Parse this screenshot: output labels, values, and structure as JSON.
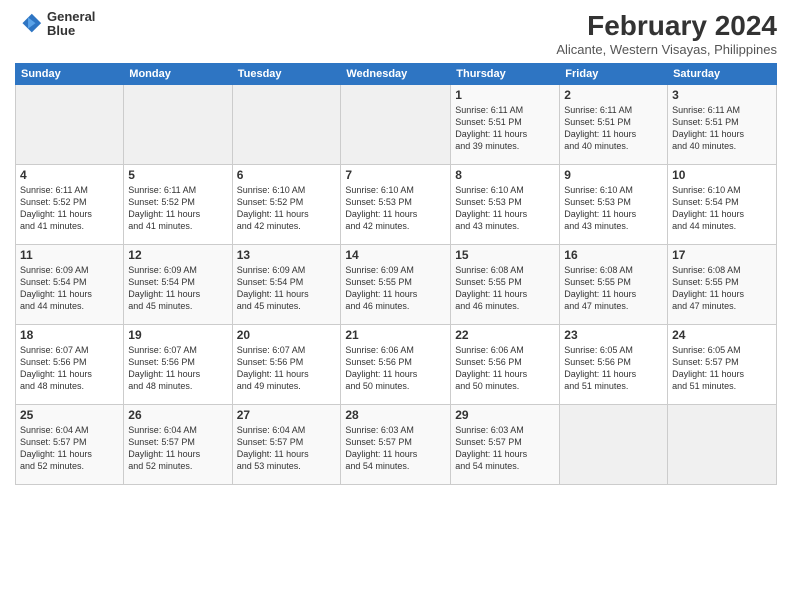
{
  "logo": {
    "line1": "General",
    "line2": "Blue"
  },
  "title": "February 2024",
  "subtitle": "Alicante, Western Visayas, Philippines",
  "days_of_week": [
    "Sunday",
    "Monday",
    "Tuesday",
    "Wednesday",
    "Thursday",
    "Friday",
    "Saturday"
  ],
  "weeks": [
    [
      {
        "day": "",
        "info": ""
      },
      {
        "day": "",
        "info": ""
      },
      {
        "day": "",
        "info": ""
      },
      {
        "day": "",
        "info": ""
      },
      {
        "day": "1",
        "info": "Sunrise: 6:11 AM\nSunset: 5:51 PM\nDaylight: 11 hours\nand 39 minutes."
      },
      {
        "day": "2",
        "info": "Sunrise: 6:11 AM\nSunset: 5:51 PM\nDaylight: 11 hours\nand 40 minutes."
      },
      {
        "day": "3",
        "info": "Sunrise: 6:11 AM\nSunset: 5:51 PM\nDaylight: 11 hours\nand 40 minutes."
      }
    ],
    [
      {
        "day": "4",
        "info": "Sunrise: 6:11 AM\nSunset: 5:52 PM\nDaylight: 11 hours\nand 41 minutes."
      },
      {
        "day": "5",
        "info": "Sunrise: 6:11 AM\nSunset: 5:52 PM\nDaylight: 11 hours\nand 41 minutes."
      },
      {
        "day": "6",
        "info": "Sunrise: 6:10 AM\nSunset: 5:52 PM\nDaylight: 11 hours\nand 42 minutes."
      },
      {
        "day": "7",
        "info": "Sunrise: 6:10 AM\nSunset: 5:53 PM\nDaylight: 11 hours\nand 42 minutes."
      },
      {
        "day": "8",
        "info": "Sunrise: 6:10 AM\nSunset: 5:53 PM\nDaylight: 11 hours\nand 43 minutes."
      },
      {
        "day": "9",
        "info": "Sunrise: 6:10 AM\nSunset: 5:53 PM\nDaylight: 11 hours\nand 43 minutes."
      },
      {
        "day": "10",
        "info": "Sunrise: 6:10 AM\nSunset: 5:54 PM\nDaylight: 11 hours\nand 44 minutes."
      }
    ],
    [
      {
        "day": "11",
        "info": "Sunrise: 6:09 AM\nSunset: 5:54 PM\nDaylight: 11 hours\nand 44 minutes."
      },
      {
        "day": "12",
        "info": "Sunrise: 6:09 AM\nSunset: 5:54 PM\nDaylight: 11 hours\nand 45 minutes."
      },
      {
        "day": "13",
        "info": "Sunrise: 6:09 AM\nSunset: 5:54 PM\nDaylight: 11 hours\nand 45 minutes."
      },
      {
        "day": "14",
        "info": "Sunrise: 6:09 AM\nSunset: 5:55 PM\nDaylight: 11 hours\nand 46 minutes."
      },
      {
        "day": "15",
        "info": "Sunrise: 6:08 AM\nSunset: 5:55 PM\nDaylight: 11 hours\nand 46 minutes."
      },
      {
        "day": "16",
        "info": "Sunrise: 6:08 AM\nSunset: 5:55 PM\nDaylight: 11 hours\nand 47 minutes."
      },
      {
        "day": "17",
        "info": "Sunrise: 6:08 AM\nSunset: 5:55 PM\nDaylight: 11 hours\nand 47 minutes."
      }
    ],
    [
      {
        "day": "18",
        "info": "Sunrise: 6:07 AM\nSunset: 5:56 PM\nDaylight: 11 hours\nand 48 minutes."
      },
      {
        "day": "19",
        "info": "Sunrise: 6:07 AM\nSunset: 5:56 PM\nDaylight: 11 hours\nand 48 minutes."
      },
      {
        "day": "20",
        "info": "Sunrise: 6:07 AM\nSunset: 5:56 PM\nDaylight: 11 hours\nand 49 minutes."
      },
      {
        "day": "21",
        "info": "Sunrise: 6:06 AM\nSunset: 5:56 PM\nDaylight: 11 hours\nand 50 minutes."
      },
      {
        "day": "22",
        "info": "Sunrise: 6:06 AM\nSunset: 5:56 PM\nDaylight: 11 hours\nand 50 minutes."
      },
      {
        "day": "23",
        "info": "Sunrise: 6:05 AM\nSunset: 5:56 PM\nDaylight: 11 hours\nand 51 minutes."
      },
      {
        "day": "24",
        "info": "Sunrise: 6:05 AM\nSunset: 5:57 PM\nDaylight: 11 hours\nand 51 minutes."
      }
    ],
    [
      {
        "day": "25",
        "info": "Sunrise: 6:04 AM\nSunset: 5:57 PM\nDaylight: 11 hours\nand 52 minutes."
      },
      {
        "day": "26",
        "info": "Sunrise: 6:04 AM\nSunset: 5:57 PM\nDaylight: 11 hours\nand 52 minutes."
      },
      {
        "day": "27",
        "info": "Sunrise: 6:04 AM\nSunset: 5:57 PM\nDaylight: 11 hours\nand 53 minutes."
      },
      {
        "day": "28",
        "info": "Sunrise: 6:03 AM\nSunset: 5:57 PM\nDaylight: 11 hours\nand 54 minutes."
      },
      {
        "day": "29",
        "info": "Sunrise: 6:03 AM\nSunset: 5:57 PM\nDaylight: 11 hours\nand 54 minutes."
      },
      {
        "day": "",
        "info": ""
      },
      {
        "day": "",
        "info": ""
      }
    ]
  ]
}
